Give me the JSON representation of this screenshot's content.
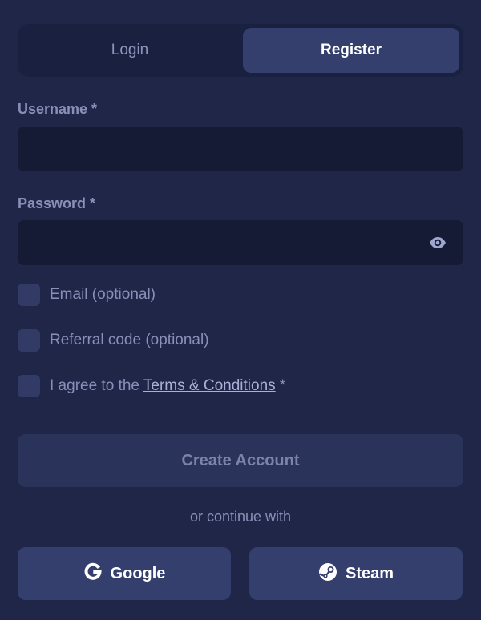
{
  "tabs": {
    "login_label": "Login",
    "register_label": "Register",
    "active": "Register"
  },
  "form": {
    "username_label": "Username *",
    "username_value": "",
    "password_label": "Password *",
    "password_value": "",
    "email_option_label": "Email (optional)",
    "referral_option_label": "Referral code (optional)",
    "terms_prefix": "I agree to the ",
    "terms_link": "Terms & Conditions",
    "terms_suffix": " *",
    "create_button_label": "Create Account"
  },
  "social": {
    "divider_text": "or continue with",
    "google_label": "Google",
    "steam_label": "Steam"
  },
  "icons": {
    "password_toggle": "eye-icon",
    "google": "google-icon",
    "steam": "steam-icon"
  },
  "colors": {
    "background": "#1f2648",
    "input_background": "#151a35",
    "active_tab": "#353f6d",
    "checkbox": "#323b66",
    "label_text": "#8990b8"
  }
}
